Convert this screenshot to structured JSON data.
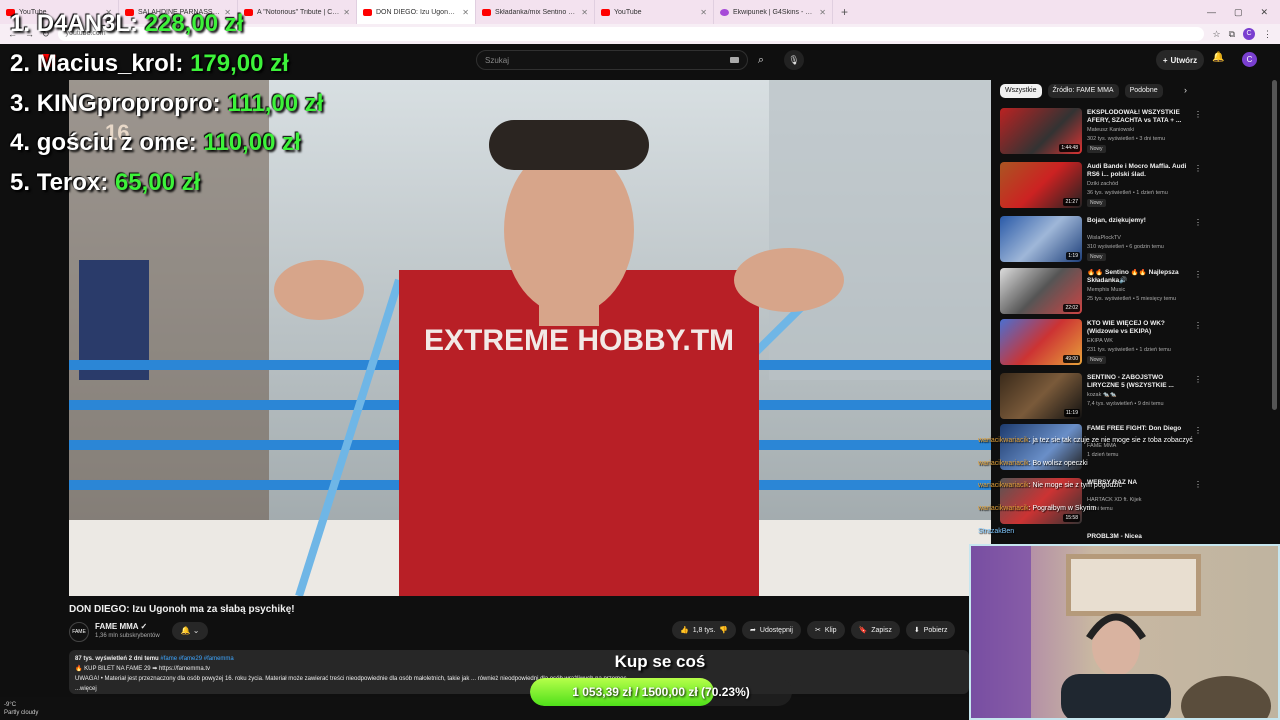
{
  "browser": {
    "tabs": [
      {
        "label": "YouTube",
        "active": false
      },
      {
        "label": "SALAHDINE PARNASSE vs MA",
        "active": false
      },
      {
        "label": "A \"Notorious\" Tribute | Conor M",
        "active": false
      },
      {
        "label": "DON DIEGO: Izu Ugonoh m",
        "active": true
      },
      {
        "label": "Składanka/mix Sentino 2 - Yo",
        "active": false
      },
      {
        "label": "YouTube",
        "active": false
      },
      {
        "label": "Ekwipunek | G4Skins - Otwierz",
        "active": false
      }
    ],
    "new_tab": "+",
    "url": "youtube.com"
  },
  "youtube": {
    "search_placeholder": "Szukaj",
    "create_label": "Utwórz",
    "avatar_letter": "C"
  },
  "video": {
    "title": "DON DIEGO: Izu Ugonoh ma za słabą psychikę!",
    "channel": "FAME MMA",
    "subscribers": "1,36 mln subskrybentów",
    "likes": "1,8 tys.",
    "share": "Udostępnij",
    "clip": "Klip",
    "save": "Zapisz",
    "download": "Pobierz",
    "shirt_text": "EXTREME HOBBY.TM",
    "badge": "16",
    "description": {
      "meta": "87 tys. wyświetleń  2 dni temu",
      "tags": "#fame #fame29 #famemma",
      "line1": "🔥 KUP BILET NA FAME 29 ➡ https://famemma.tv",
      "line2": "UWAGA! • Materiał jest przeznaczony dla osób powyżej 16. roku życia. Materiał może zawierać treści nieodpowiednie dla osób małoletnich, takie jak ... również nieodpowiedni dla osób wrażliwych na przemoc.",
      "more": "...więcej"
    }
  },
  "filters": [
    "Wszystkie",
    "Źródło: FAME MMA",
    "Podobne"
  ],
  "recommendations": [
    {
      "title": "EKSPLODOWAŁ! WSZYSTKIE AFERY, SZACHTA vs TATA + ...",
      "channel": "Mateusz Kaniowski",
      "views": "302 tys. wyświetleń • 3 dni temu",
      "badge": "Nowy",
      "duration": "1:44:48"
    },
    {
      "title": "Audi Bande i Mocro Maffia. Audi RS6 i... polski ślad.",
      "channel": "Dziki zachód",
      "views": "36 tys. wyświetleń • 1 dzień temu",
      "badge": "Nowy",
      "duration": "21:27"
    },
    {
      "title": "Bojan, dziękujemy!",
      "channel": "WislaPlockTV",
      "views": "310 wyświetleń • 6 godzin temu",
      "badge": "Nowy",
      "duration": "1:19"
    },
    {
      "title": "🔥🔥 Sentino 🔥🔥 Najlepsza Składanka🔊",
      "channel": "Memphis Music",
      "views": "25 tys. wyświetleń • 5 miesięcy temu",
      "badge": "",
      "duration": "22:02"
    },
    {
      "title": "KTO WIE WIĘCEJ O WK? (Widzowie vs EKIPA)",
      "channel": "EKIPA WK",
      "views": "231 tys. wyświetleń • 1 dzień temu",
      "badge": "Nowy",
      "duration": "49:00"
    },
    {
      "title": "SENTINO - ZABÓJSTWO LIRYCZNE 5 (WSZYSTKIE ...",
      "channel": "kozak 🐀🐀",
      "views": "7,4 tys. wyświetleń • 9 dni temu",
      "badge": "",
      "duration": "11:19"
    },
    {
      "title": "FAME FREE FIGHT: Don Diego",
      "channel": "FAME MMA",
      "views": "1 dzień temu",
      "badge": "",
      "duration": ""
    },
    {
      "title": "WERSY RAZ NA",
      "channel": "HARTACK XD ft. Kijek",
      "views": "3 dni temu",
      "badge": "",
      "duration": "15:58"
    }
  ],
  "rec_partial": "PROBL3M - Nicea",
  "overlay": {
    "leaderboard": [
      {
        "rank": "1.",
        "name": "D4AN3L:",
        "amount": "228,00 zł"
      },
      {
        "rank": "2.",
        "name": "Macius_krol:",
        "amount": "179,00 zł"
      },
      {
        "rank": "3.",
        "name": "KINGpropropro:",
        "amount": "111,00 zł"
      },
      {
        "rank": "4.",
        "name": "gościu z ome:",
        "amount": "110,00 zł"
      },
      {
        "rank": "5.",
        "name": "Terox:",
        "amount": "65,00 zł"
      }
    ],
    "chat": [
      {
        "user": "wariacikwariacik",
        "msg": "ja tez sie tak czuje ze nie moge sie z toba zobaczyć"
      },
      {
        "user": "wariacikwariacik",
        "msg": "Bo wolisz opeczki"
      },
      {
        "user": "wariacikwariacik",
        "msg": "Nie moge sie z tym pogodzic"
      },
      {
        "user": "wariacikwariacik",
        "msg": "Pograłbym w Skyrim"
      },
      {
        "user": "StrazakBen",
        "msg": ""
      }
    ],
    "goal": {
      "title": "Kup se coś",
      "current": "1 053,39 zł",
      "target": "1500,00 zł",
      "percent_label": "(70.23%)",
      "progress": 0.7023,
      "separator": "/"
    }
  },
  "taskbar": {
    "weather_temp": "-9°C",
    "weather_text": "Partly cloudy"
  },
  "colors": {
    "amount_green": "#3df23a",
    "youtube_red": "#ff0000",
    "goal_green": "#4fe01a"
  }
}
